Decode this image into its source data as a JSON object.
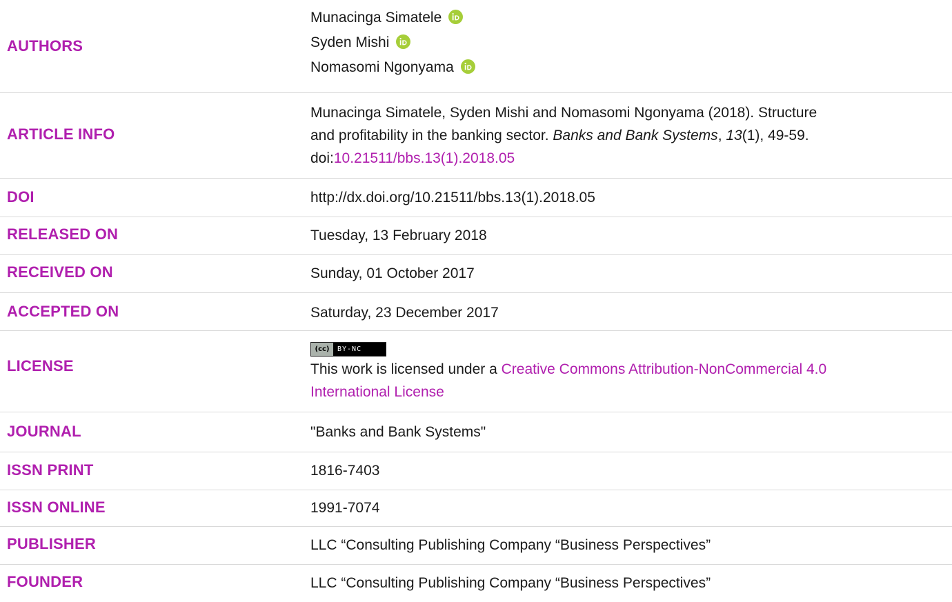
{
  "authors": {
    "label": "AUTHORS",
    "items": [
      {
        "name": "Munacinga Simatele"
      },
      {
        "name": "Syden Mishi"
      },
      {
        "name": "Nomasomi Ngonyama"
      }
    ]
  },
  "article_info": {
    "label": "ARTICLE INFO",
    "line1": "Munacinga Simatele, Syden Mishi and Nomasomi Ngonyama (2018). Structure",
    "line2_a": "and profitability in the banking sector. ",
    "journal_italic": "Banks and Bank Systems",
    "comma": ", ",
    "volume_italic": "13",
    "issue_pages": "(1), 49-59.",
    "doi_prefix": "doi:",
    "doi_link": "10.21511/bbs.13(1).2018.05"
  },
  "doi": {
    "label": "DOI",
    "value": "http://dx.doi.org/10.21511/bbs.13(1).2018.05"
  },
  "released": {
    "label": "RELEASED ON",
    "value": "Tuesday, 13 February 2018"
  },
  "received": {
    "label": "RECEIVED ON",
    "value": "Sunday, 01 October 2017"
  },
  "accepted": {
    "label": "ACCEPTED ON",
    "value": "Saturday, 23 December 2017"
  },
  "license": {
    "label": "LICENSE",
    "badge_cc": "(cc)",
    "badge_text": "BY-NC",
    "text": "This work is licensed under a ",
    "link_line1": "Creative Commons Attribution-NonCommercial 4.0",
    "link_line2": "International License"
  },
  "journal": {
    "label": "JOURNAL",
    "value": "\"Banks and Bank Systems\""
  },
  "issn_print": {
    "label": "ISSN PRINT",
    "value": "1816-7403"
  },
  "issn_online": {
    "label": "ISSN ONLINE",
    "value": "1991-7074"
  },
  "publisher": {
    "label": "PUBLISHER",
    "value": "LLC “Consulting Publishing Company “Business Perspectives”"
  },
  "founder": {
    "label": "FOUNDER",
    "value": "LLC “Consulting Publishing Company “Business Perspectives”"
  },
  "colors": {
    "accent": "#b01fae",
    "orcid": "#a6ce39",
    "divider": "#d9d9d9"
  }
}
